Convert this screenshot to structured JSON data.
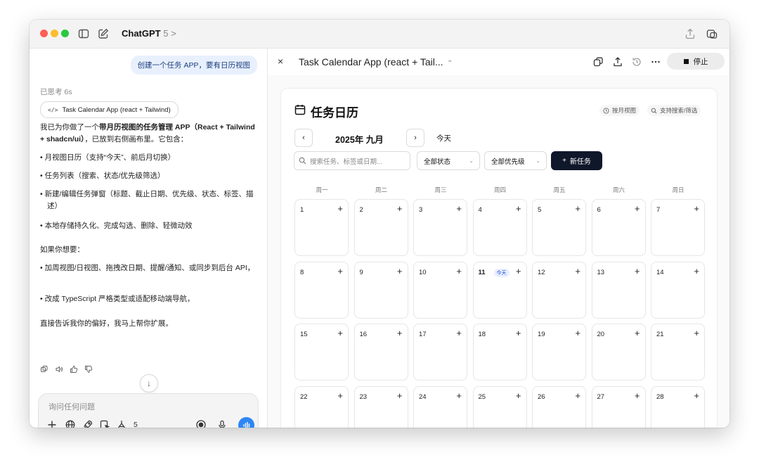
{
  "app": {
    "name": "ChatGPT",
    "version": "5",
    "version_chevron": ">"
  },
  "chat": {
    "user_message": "创建一个任务 APP，要有日历视图",
    "thought_label": "已思考 6s",
    "artifact_chip": {
      "glyph": "</>",
      "label": "Task Calendar App (react + Tailwind)"
    },
    "intro_prefix": "我已为你做了一个",
    "intro_bold": "带月历视图的任务管理 APP（React + Tailwind + shadcn/ui）",
    "intro_suffix": "，已放到右侧画布里。它包含：",
    "features": [
      "• 月视图日历（支持“今天”、前后月切换）",
      "• 任务列表（搜索、状态/优先级筛选）",
      "• 新建/编辑任务弹窗（标题、截止日期、优先级、状态、标签、描述）",
      "• 本地存储持久化、完成勾选、删除、轻微动效"
    ],
    "followup_label": "如果你想要：",
    "followups": [
      "• 加周视图/日视图、拖拽改日期、提醒/通知、或同步到后台 API，",
      "• 改成 TypeScript 严格类型或适配移动端导航，"
    ],
    "closing": "直接告诉我你的偏好，我马上帮你扩展。",
    "scroll_glyph": "↓",
    "composer": {
      "placeholder": "询问任何问题",
      "tools_count": "5"
    }
  },
  "artifact": {
    "close_glyph": "×",
    "title": "Task Calendar App (react + Tail...",
    "title_chevron": "⌄",
    "stop_label": "停止",
    "calendar": {
      "title": "任务日历",
      "chip_month_view": "按月视图",
      "chip_search": "支持搜索/筛选",
      "prev": "‹",
      "next": "›",
      "month_label": "2025年 九月",
      "today_button": "今天",
      "search_placeholder": "搜索任务、标签或日期...",
      "status_filter": "全部状态",
      "priority_filter": "全部优先级",
      "new_task": "新任务",
      "new_task_glyph": "+",
      "weekdays": [
        "周一",
        "周二",
        "周三",
        "周四",
        "周五",
        "周六",
        "周日"
      ],
      "days": [
        "1",
        "2",
        "3",
        "4",
        "5",
        "6",
        "7",
        "8",
        "9",
        "10",
        "11",
        "12",
        "13",
        "14",
        "15",
        "16",
        "17",
        "18",
        "19",
        "20",
        "21",
        "22",
        "23",
        "24",
        "25",
        "26",
        "27",
        "28"
      ],
      "today_day": "11",
      "today_tag": "今天",
      "add_glyph": "+"
    }
  },
  "colors": {
    "accent_blue": "#2e86f5",
    "primary_dark": "#0f172a",
    "user_bubble": "#e8f0fe"
  }
}
